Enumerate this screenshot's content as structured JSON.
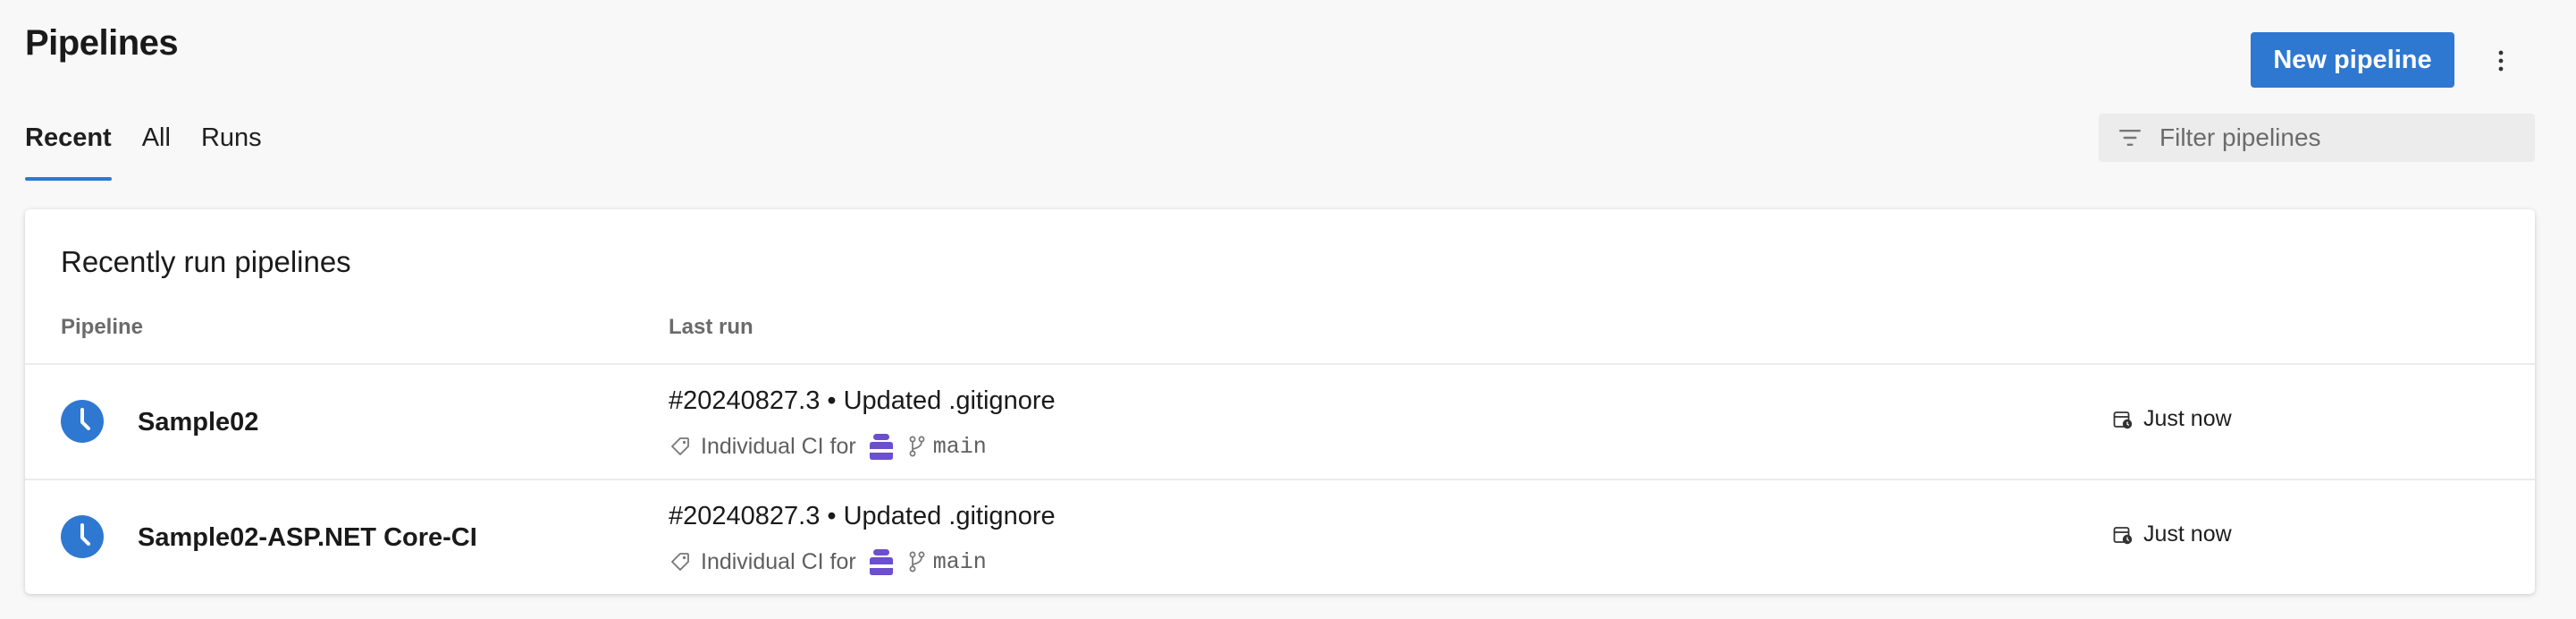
{
  "page": {
    "title": "Pipelines"
  },
  "header": {
    "new_pipeline_label": "New pipeline",
    "more_icon": "more-vertical-icon"
  },
  "tabs": [
    {
      "label": "Recent",
      "active": true
    },
    {
      "label": "All",
      "active": false
    },
    {
      "label": "Runs",
      "active": false
    }
  ],
  "filter": {
    "placeholder": "Filter pipelines",
    "icon": "filter-icon"
  },
  "card": {
    "title": "Recently run pipelines",
    "columns": {
      "pipeline": "Pipeline",
      "last_run": "Last run"
    }
  },
  "rows": [
    {
      "name": "Sample02",
      "run_title": "#20240827.3 • Updated .gitignore",
      "trigger": "Individual CI for",
      "branch": "main",
      "time": "Just now",
      "status": "in-progress"
    },
    {
      "name": "Sample02-ASP.NET Core-CI",
      "run_title": "#20240827.3 • Updated .gitignore",
      "trigger": "Individual CI for",
      "branch": "main",
      "time": "Just now",
      "status": "in-progress"
    }
  ],
  "colors": {
    "accent": "#2f78d1",
    "repo_icon": "#6b4fcf"
  }
}
